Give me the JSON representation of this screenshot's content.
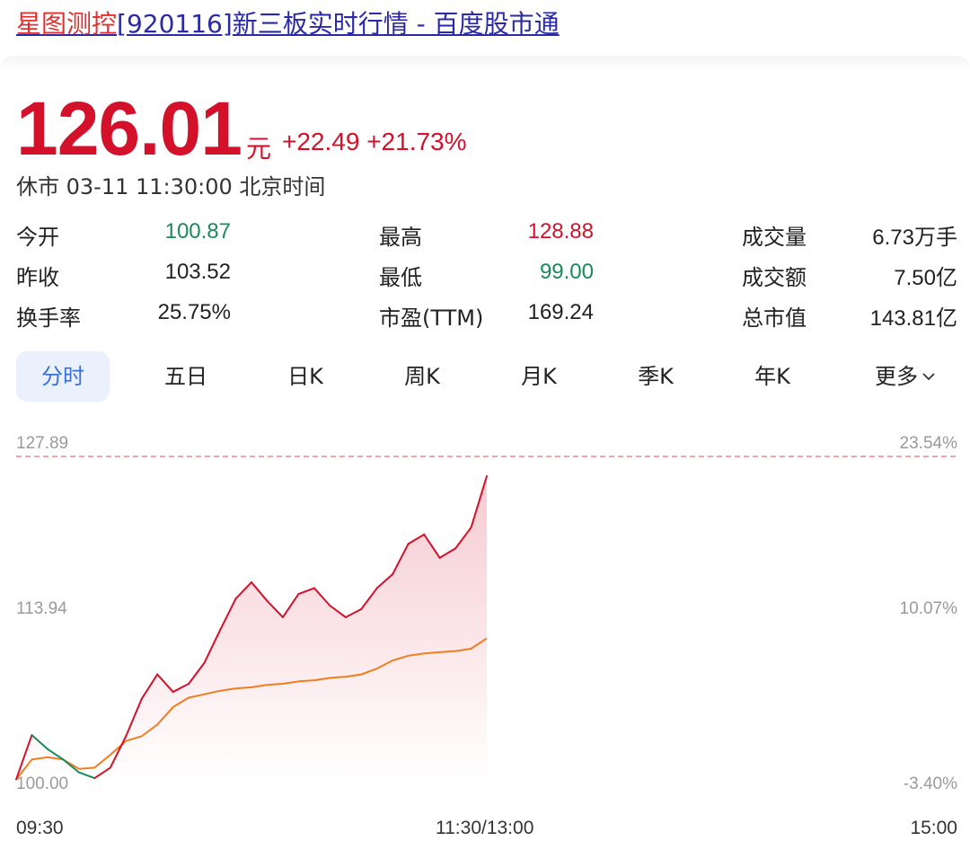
{
  "header": {
    "title_highlight": "星图测控",
    "title_rest": "[920116]新三板实时行情 - 百度股市通"
  },
  "quote": {
    "price": "126.01",
    "unit": "元",
    "change": "+22.49",
    "change_pct": "+21.73%",
    "status": "休市 03-11 11:30:00 北京时间"
  },
  "stats": [
    {
      "label": "今开",
      "value": "100.87",
      "trend": "down"
    },
    {
      "label": "最高",
      "value": "128.88",
      "trend": "up"
    },
    {
      "label": "成交量",
      "value": "6.73万手",
      "trend": "neutral"
    },
    {
      "label": "昨收",
      "value": "103.52",
      "trend": "neutral"
    },
    {
      "label": "最低",
      "value": "99.00",
      "trend": "down"
    },
    {
      "label": "成交额",
      "value": "7.50亿",
      "trend": "neutral"
    },
    {
      "label": "换手率",
      "value": "25.75%",
      "trend": "neutral"
    },
    {
      "label": "市盈(TTM)",
      "value": "169.24",
      "trend": "neutral"
    },
    {
      "label": "总市值",
      "value": "143.81亿",
      "trend": "neutral"
    }
  ],
  "tabs": [
    "分时",
    "五日",
    "日K",
    "周K",
    "月K",
    "季K",
    "年K",
    "更多"
  ],
  "active_tab": "分时",
  "colors": {
    "up": "#d4112a",
    "down": "#1a8a5a",
    "avg_line": "#f07d1e",
    "tab_active_bg": "#eaf1fd",
    "tab_active_text": "#3a6fd8"
  },
  "chart_data": {
    "type": "line",
    "y_left_labels": [
      "127.89",
      "113.94",
      "100.00"
    ],
    "y_right_labels": [
      "23.54%",
      "10.07%",
      "-3.40%"
    ],
    "x_labels": [
      "09:30",
      "11:30/13:00",
      "15:00"
    ],
    "ylim": [
      100.0,
      127.89
    ],
    "reference_line": 127.89,
    "x": [
      0,
      4,
      8,
      12,
      16,
      20,
      24,
      28,
      32,
      36,
      40,
      44,
      48,
      52,
      56,
      60,
      64,
      68,
      72,
      76,
      80,
      84,
      88,
      92,
      96,
      100,
      104,
      108,
      112,
      116,
      120
    ],
    "series": [
      {
        "values": [
          100.2,
          104.0,
          102.8,
          101.9,
          100.8,
          100.3,
          101.2,
          103.9,
          107.1,
          109.2,
          107.7,
          108.4,
          110.2,
          113.0,
          115.7,
          117.1,
          115.5,
          114.1,
          116.1,
          116.6,
          115.1,
          114.1,
          114.8,
          116.6,
          117.8,
          120.4,
          121.2,
          119.2,
          120.0,
          121.8,
          126.2
        ],
        "color": "#d4112a"
      },
      {
        "values": [
          100.2,
          101.9,
          102.1,
          101.9,
          101.1,
          101.2,
          102.3,
          103.5,
          103.9,
          104.9,
          106.4,
          107.2,
          107.5,
          107.8,
          108.0,
          108.1,
          108.3,
          108.4,
          108.6,
          108.7,
          108.9,
          109.0,
          109.2,
          109.7,
          110.4,
          110.8,
          111.0,
          111.1,
          111.2,
          111.4,
          112.3
        ],
        "color": "#f07d1e"
      }
    ]
  }
}
